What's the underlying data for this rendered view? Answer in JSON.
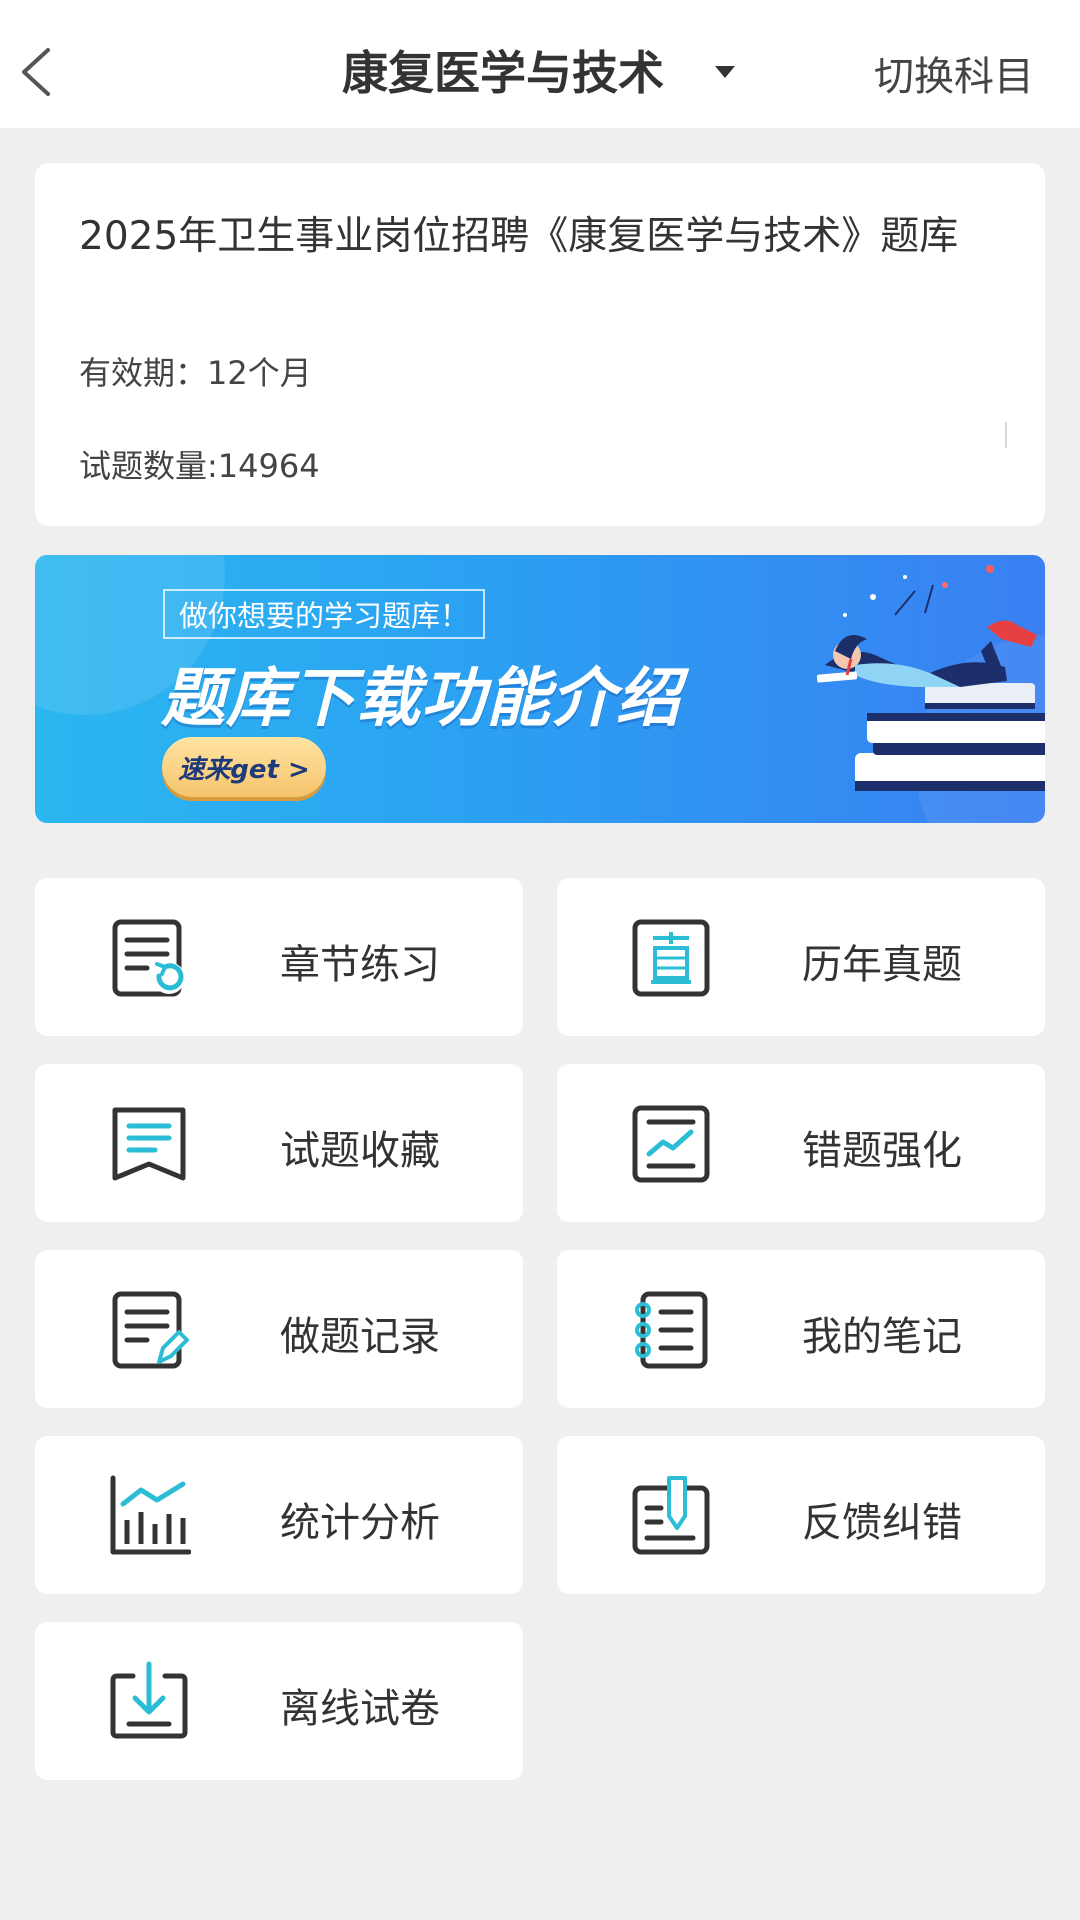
{
  "header": {
    "title": "康复医学与技术",
    "switch_label": "切换科目"
  },
  "info_card": {
    "title": "2025年卫生事业岗位招聘《康复医学与技术》题库",
    "validity": "有效期：12个月",
    "question_count": "试题数量:14964"
  },
  "banner": {
    "subtitle": "做你想要的学习题库！",
    "title": "题库下载功能介绍",
    "cta": "速来get >"
  },
  "menu": {
    "items": [
      {
        "label": "章节练习",
        "icon": "chapter-practice-icon"
      },
      {
        "label": "历年真题",
        "icon": "past-exams-icon"
      },
      {
        "label": "试题收藏",
        "icon": "favorites-icon"
      },
      {
        "label": "错题强化",
        "icon": "wrong-questions-icon"
      },
      {
        "label": "做题记录",
        "icon": "practice-record-icon"
      },
      {
        "label": "我的笔记",
        "icon": "notebook-icon"
      },
      {
        "label": "统计分析",
        "icon": "statistics-icon"
      },
      {
        "label": "反馈纠错",
        "icon": "feedback-icon"
      },
      {
        "label": "离线试卷",
        "icon": "offline-download-icon"
      }
    ]
  },
  "colors": {
    "accent": "#2bbdd6",
    "icon_dark": "#333333",
    "background": "#efefef"
  }
}
